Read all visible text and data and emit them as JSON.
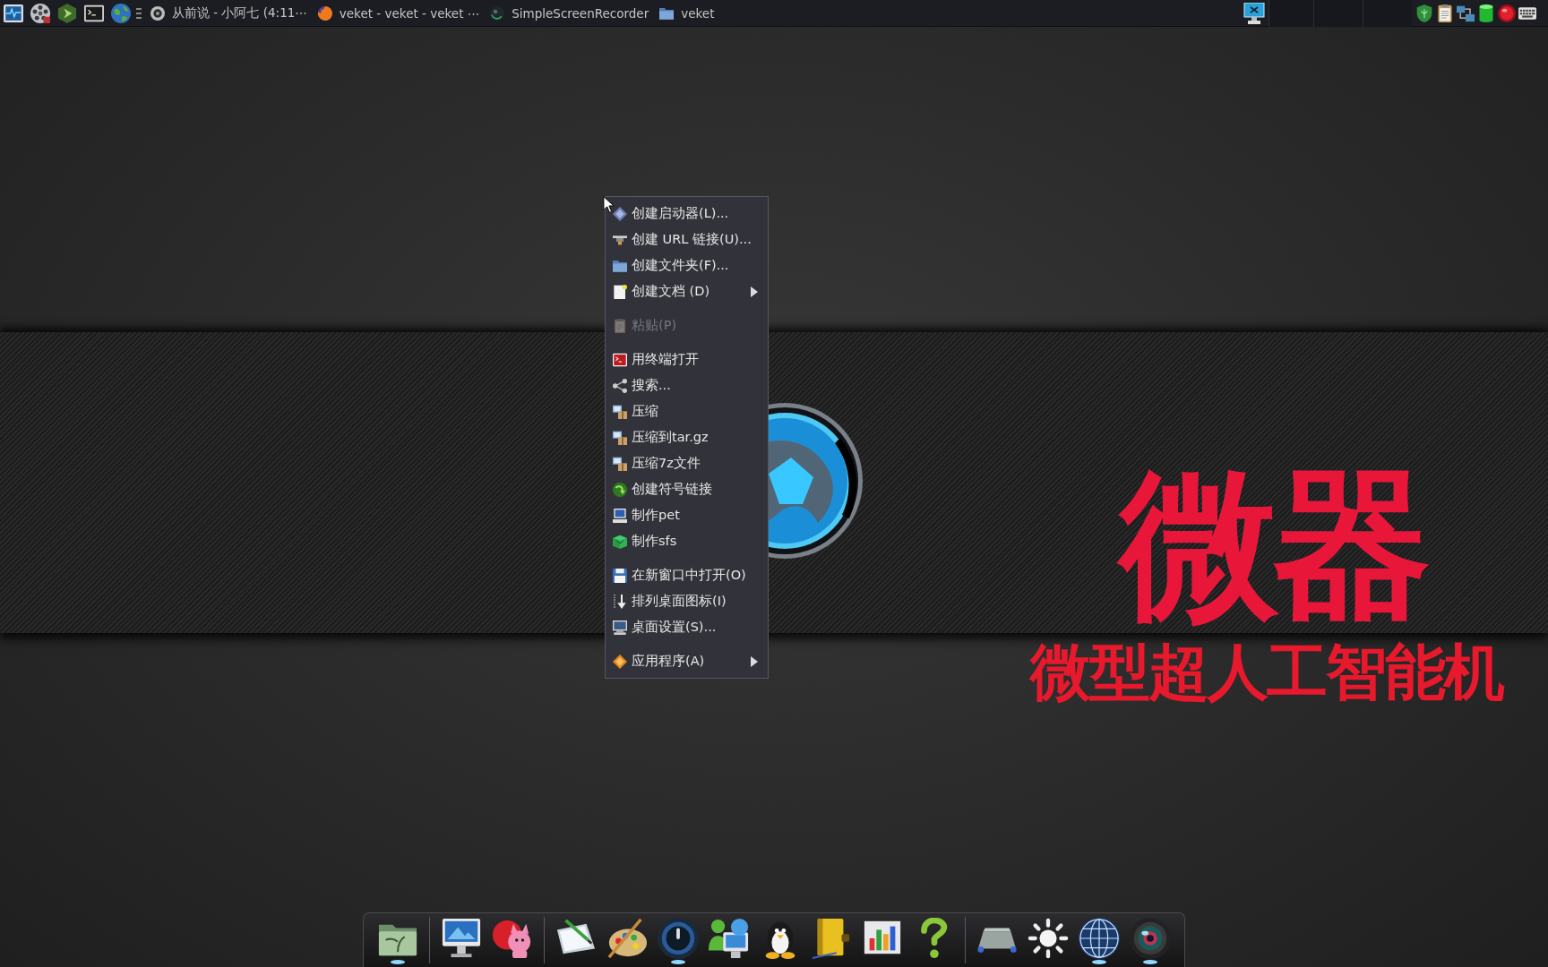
{
  "top_panel": {
    "tasks": [
      {
        "title": "从前说 - 小阿七 (4:11⋯"
      },
      {
        "title": "veket - veket - veket ⋯"
      },
      {
        "title": "SimpleScreenRecorder"
      },
      {
        "title": "veket"
      }
    ]
  },
  "wallpaper": {
    "title": "微器",
    "subtitle": "微型超人工智能机"
  },
  "context_menu": {
    "groups": [
      {
        "items": [
          {
            "label": "创建启动器(L)...",
            "disabled": false,
            "submenu": false
          },
          {
            "label": "创建 URL 链接(U)...",
            "disabled": false,
            "submenu": false
          },
          {
            "label": "创建文件夹(F)...",
            "disabled": false,
            "submenu": false
          },
          {
            "label": "创建文档 (D)",
            "disabled": false,
            "submenu": true
          }
        ]
      },
      {
        "items": [
          {
            "label": "粘贴(P)",
            "disabled": true,
            "submenu": false
          }
        ]
      },
      {
        "items": [
          {
            "label": "用终端打开",
            "disabled": false,
            "submenu": false
          },
          {
            "label": "搜索...",
            "disabled": false,
            "submenu": false
          },
          {
            "label": "压缩",
            "disabled": false,
            "submenu": false
          },
          {
            "label": "压缩到tar.gz",
            "disabled": false,
            "submenu": false
          },
          {
            "label": "压缩7z文件",
            "disabled": false,
            "submenu": false
          },
          {
            "label": "创建符号链接",
            "disabled": false,
            "submenu": false
          },
          {
            "label": "制作pet",
            "disabled": false,
            "submenu": false
          },
          {
            "label": "制作sfs",
            "disabled": false,
            "submenu": false
          }
        ]
      },
      {
        "items": [
          {
            "label": "在新窗口中打开(O)",
            "disabled": false,
            "submenu": false
          },
          {
            "label": "排列桌面图标(I)",
            "disabled": false,
            "submenu": false
          },
          {
            "label": "桌面设置(S)...",
            "disabled": false,
            "submenu": false
          }
        ]
      },
      {
        "items": [
          {
            "label": "应用程序(A)",
            "disabled": false,
            "submenu": true
          }
        ]
      }
    ]
  },
  "dock": {
    "groups": [
      {
        "items": [
          {
            "running": true
          }
        ]
      },
      {
        "items": [
          {
            "running": false
          },
          {
            "running": false
          }
        ]
      },
      {
        "items": [
          {
            "running": false
          },
          {
            "running": false
          },
          {
            "running": true
          },
          {
            "running": false
          },
          {
            "running": false
          },
          {
            "running": false
          },
          {
            "running": false
          },
          {
            "running": false
          }
        ]
      },
      {
        "items": [
          {
            "running": false
          },
          {
            "running": false
          },
          {
            "running": true
          },
          {
            "running": true
          }
        ]
      }
    ]
  }
}
